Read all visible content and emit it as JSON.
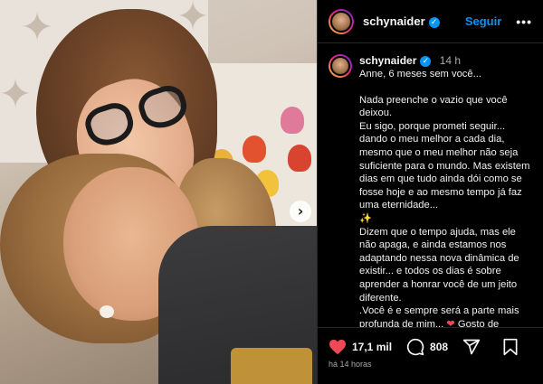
{
  "post": {
    "username": "schynaider",
    "follow_label": "Seguir",
    "more_label": "•••"
  },
  "comment": {
    "username": "schynaider",
    "time": "14 h",
    "lines": [
      "Anne, 6 meses sem você...",
      "",
      "Nada preenche o vazio que você deixou.",
      "Eu sigo, porque prometi seguir... dando o meu melhor a cada dia, mesmo que o meu melhor não seja suficiente para o mundo. Mas existem dias em que tudo ainda dói como se fosse hoje e ao mesmo tempo já faz uma eternidade...",
      "Dizem que o tempo ajuda, mas ele não apaga, e ainda estamos nos adaptando nessa nova dinâmica de existir... e todos os dias é sobre aprender a honrar você de um jeito diferente.",
      ".Você é e sempre será a parte mais profunda de mim...",
      "Gosto de lembrar de você assim... sorrindo e sempre linda, vencendo todos os dias mesmo quando lutava, tantas vezes."
    ],
    "emojis": {
      "sparkles": "✨",
      "heart": "❤"
    }
  },
  "actions": {
    "likes": "17,1 mil",
    "comments": "808"
  },
  "post_date": "há 14 horas",
  "colors": {
    "accent": "#0095f6",
    "like_red": "#ed4956",
    "background": "#000000",
    "muted_text": "#a8a8a8"
  },
  "icons": [
    "verified-badge-icon",
    "next-arrow-icon",
    "heart-icon",
    "comment-icon",
    "share-icon",
    "bookmark-icon"
  ]
}
